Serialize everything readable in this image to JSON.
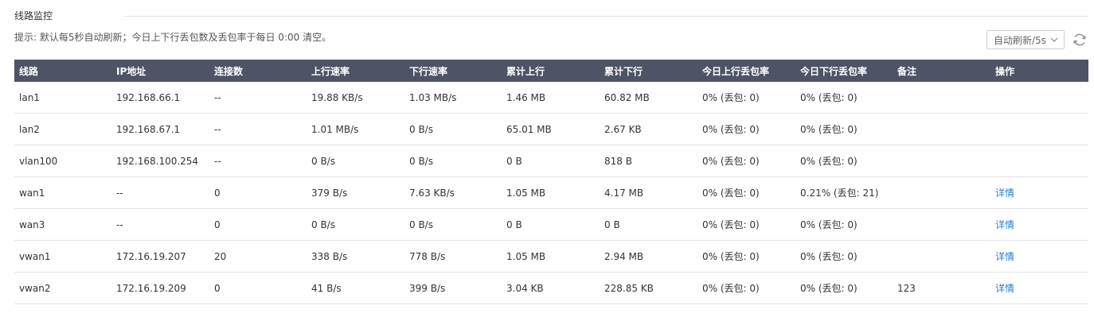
{
  "section": {
    "title": "线路监控"
  },
  "hint": "提示: 默认每5秒自动刷新；今日上下行丢包数及丢包率于每日 0:00 清空。",
  "refresh": {
    "selected": "自动刷新/5s",
    "icon": "refresh-icon"
  },
  "table": {
    "headers": [
      "线路",
      "IP地址",
      "连接数",
      "上行速率",
      "下行速率",
      "累计上行",
      "累计下行",
      "今日上行丢包率",
      "今日下行丢包率",
      "备注",
      "操作"
    ],
    "rows": [
      {
        "line": "lan1",
        "ip": "192.168.66.1",
        "conn": "--",
        "up_rate": "19.88 KB/s",
        "down_rate": "1.03 MB/s",
        "total_up": "1.46 MB",
        "total_down": "60.82 MB",
        "up_loss": "0% (丢包: 0)",
        "down_loss": "0% (丢包: 0)",
        "note": "",
        "action": ""
      },
      {
        "line": "lan2",
        "ip": "192.168.67.1",
        "conn": "--",
        "up_rate": "1.01 MB/s",
        "down_rate": "0 B/s",
        "total_up": "65.01 MB",
        "total_down": "2.67 KB",
        "up_loss": "0% (丢包: 0)",
        "down_loss": "0% (丢包: 0)",
        "note": "",
        "action": ""
      },
      {
        "line": "vlan100",
        "ip": "192.168.100.254",
        "conn": "--",
        "up_rate": "0 B/s",
        "down_rate": "0 B/s",
        "total_up": "0 B",
        "total_down": "818 B",
        "up_loss": "0% (丢包: 0)",
        "down_loss": "0% (丢包: 0)",
        "note": "",
        "action": ""
      },
      {
        "line": "wan1",
        "ip": "--",
        "conn": "0",
        "up_rate": "379 B/s",
        "down_rate": "7.63 KB/s",
        "total_up": "1.05 MB",
        "total_down": "4.17 MB",
        "up_loss": "0% (丢包: 0)",
        "down_loss": "0.21% (丢包: 21)",
        "note": "",
        "action": "详情"
      },
      {
        "line": "wan3",
        "ip": "--",
        "conn": "0",
        "up_rate": "0 B/s",
        "down_rate": "0 B/s",
        "total_up": "0 B",
        "total_down": "0 B",
        "up_loss": "0% (丢包: 0)",
        "down_loss": "0% (丢包: 0)",
        "note": "",
        "action": "详情"
      },
      {
        "line": "vwan1",
        "ip": "172.16.19.207",
        "conn": "20",
        "up_rate": "338 B/s",
        "down_rate": "778 B/s",
        "total_up": "1.05 MB",
        "total_down": "2.94 MB",
        "up_loss": "0% (丢包: 0)",
        "down_loss": "0% (丢包: 0)",
        "note": "",
        "action": "详情"
      },
      {
        "line": "vwan2",
        "ip": "172.16.19.209",
        "conn": "0",
        "up_rate": "41 B/s",
        "down_rate": "399 B/s",
        "total_up": "3.04 KB",
        "total_down": "228.85 KB",
        "up_loss": "0% (丢包: 0)",
        "down_loss": "0% (丢包: 0)",
        "note": "123",
        "action": "详情"
      }
    ]
  },
  "colors": {
    "header_bg": "#4e5466",
    "link": "#2b7bd9",
    "row_border": "#e3e3e3"
  }
}
